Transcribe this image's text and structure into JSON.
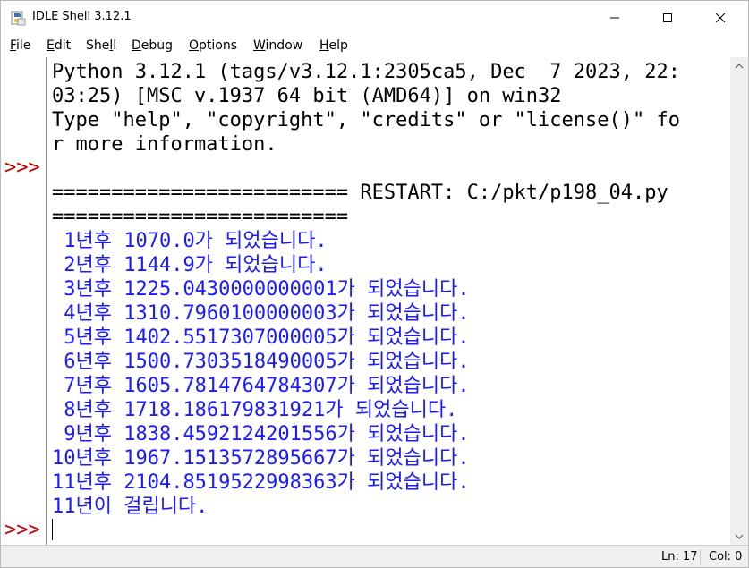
{
  "window": {
    "title": "IDLE Shell 3.12.1",
    "controls": {
      "minimize": "─",
      "maximize": "☐",
      "close": "✕"
    }
  },
  "menu": {
    "items": [
      {
        "key": "F",
        "rest": "ile"
      },
      {
        "key": "E",
        "rest": "dit"
      },
      {
        "pre": "She",
        "key": "l",
        "rest": "l"
      },
      {
        "key": "D",
        "rest": "ebug"
      },
      {
        "key": "O",
        "rest": "ptions"
      },
      {
        "key": "W",
        "rest": "indow"
      },
      {
        "key": "H",
        "rest": "elp"
      }
    ]
  },
  "shell": {
    "prompt": ">>>",
    "banner": [
      "Python 3.12.1 (tags/v3.12.1:2305ca5, Dec  7 2023, 22:",
      "03:25) [MSC v.1937 64 bit (AMD64)] on win32",
      "Type \"help\", \"copyright\", \"credits\" or \"license()\" fo",
      "r more information."
    ],
    "restart": [
      "========================= RESTART: C:/pkt/p198_04.py",
      "========================="
    ],
    "output": [
      " 1년후 1070.0가 되었습니다.",
      " 2년후 1144.9가 되었습니다.",
      " 3년후 1225.0430000000001가 되었습니다.",
      " 4년후 1310.7960100000003가 되었습니다.",
      " 5년후 1402.5517307000005가 되었습니다.",
      " 6년후 1500.7303518490005가 되었습니다.",
      " 7년후 1605.7814764784307가 되었습니다.",
      " 8년후 1718.186179831921가 되었습니다.",
      " 9년후 1838.4592124201556가 되었습니다.",
      "10년후 1967.1513572895667가 되었습니다.",
      "11년후 2104.8519522998363가 되었습니다.",
      "11년이 걸립니다."
    ]
  },
  "status": {
    "ln": "Ln: 17",
    "col": "Col: 0"
  },
  "colors": {
    "prompt": "#c00000",
    "output": "#1a1aff",
    "text": "#000000"
  },
  "icons": [
    "python-idle-icon",
    "scroll-up-icon",
    "scroll-down-icon"
  ]
}
